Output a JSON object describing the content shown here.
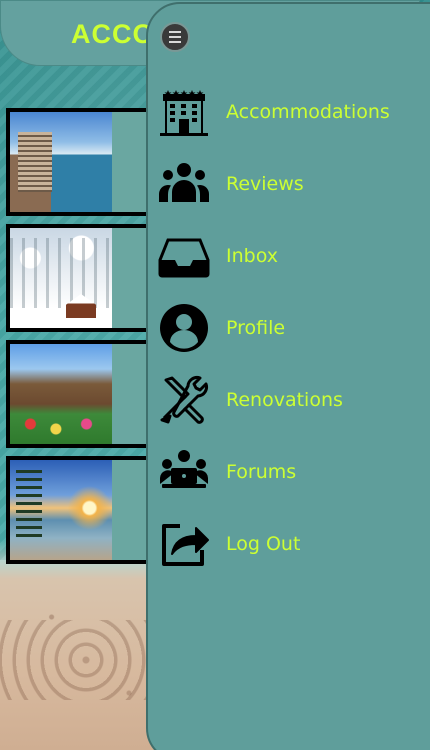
{
  "header": {
    "title": "ACCO"
  },
  "menu": {
    "items": [
      {
        "label": "Accommodations",
        "icon": "hotel-icon"
      },
      {
        "label": "Reviews",
        "icon": "users-group-icon"
      },
      {
        "label": "Inbox",
        "icon": "inbox-icon"
      },
      {
        "label": "Profile",
        "icon": "user-circle-icon"
      },
      {
        "label": "Renovations",
        "icon": "tools-icon"
      },
      {
        "label": "Forums",
        "icon": "forum-laptop-icon"
      },
      {
        "label": "Log Out",
        "icon": "logout-share-icon"
      }
    ]
  },
  "listings": [
    {
      "photo": "resort"
    },
    {
      "photo": "snow-cabin"
    },
    {
      "photo": "garden-village"
    },
    {
      "photo": "palm-beach-sunset"
    }
  ],
  "colors": {
    "accent": "#ccff33",
    "drawer": "#5f9e9b",
    "header": "#64a19f"
  }
}
